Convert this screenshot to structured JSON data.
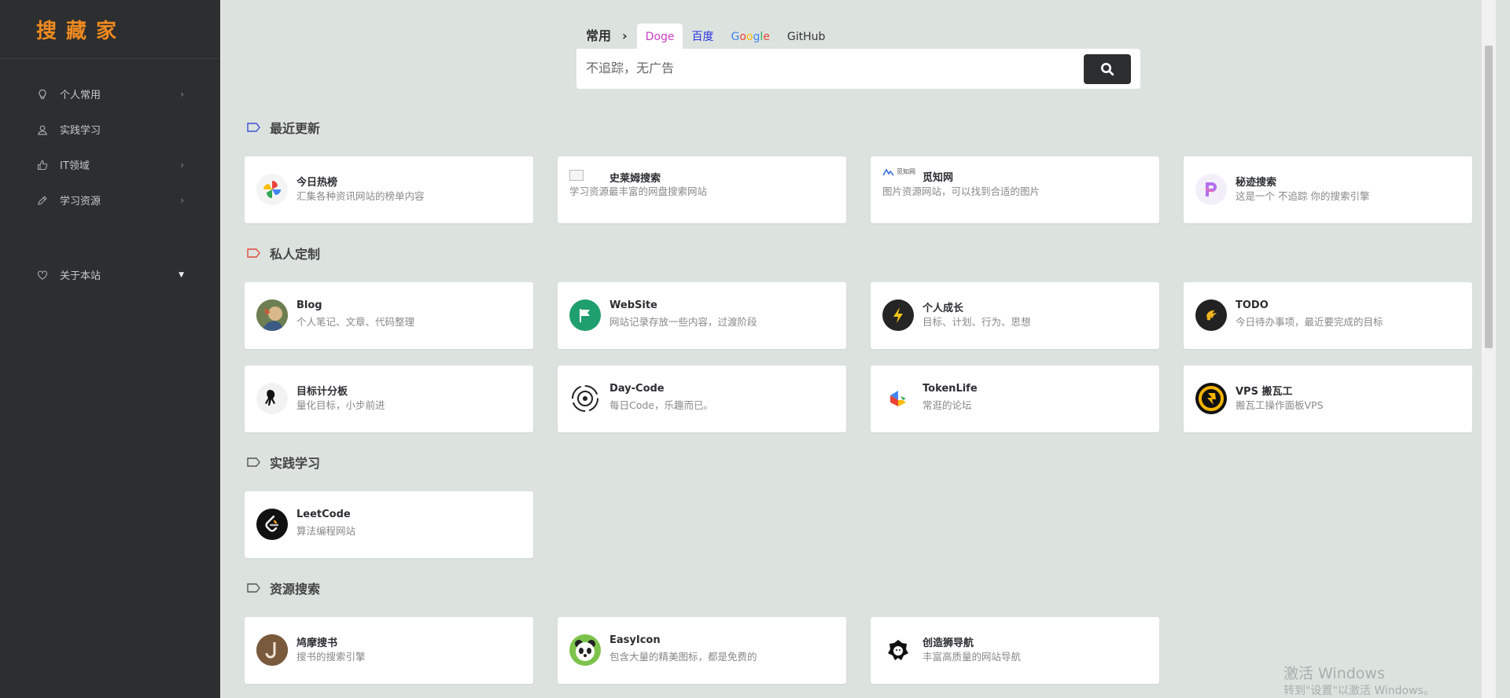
{
  "logo": "搜藏家",
  "sidebar": {
    "items": [
      {
        "label": "个人常用",
        "has_arrow": true
      },
      {
        "label": "实践学习",
        "has_arrow": false
      },
      {
        "label": "IT领域",
        "has_arrow": true
      },
      {
        "label": "学习资源",
        "has_arrow": true
      }
    ],
    "about": {
      "label": "关于本站"
    },
    "arrow_glyph": "›",
    "about_glyph": "▼"
  },
  "search": {
    "group_label": "常用",
    "group_chevron": "›",
    "tabs": {
      "doge": "Doge",
      "baidu": "百度",
      "github": "GitHub"
    },
    "google": {
      "g1": "G",
      "o1": "o",
      "o2": "o",
      "g2": "g",
      "l": "l",
      "e": "e"
    },
    "placeholder": "不追踪，无广告"
  },
  "sections": {
    "recent": {
      "title": "最近更新",
      "cards": [
        {
          "title": "今日热榜",
          "desc": "汇集各种资讯网站的榜单内容"
        },
        {
          "title": "史莱姆搜索",
          "desc": "学习资源最丰富的网盘搜索网站"
        },
        {
          "title": "觅知网",
          "desc": "图片资源网站，可以找到合适的图片",
          "logo_text": "觅知网"
        },
        {
          "title": "秘迹搜索",
          "desc": "这是一个 不追踪 你的搜索引擎"
        }
      ]
    },
    "private": {
      "title": "私人定制",
      "cards": [
        {
          "title": "Blog",
          "desc": "个人笔记、文章、代码整理"
        },
        {
          "title": "WebSite",
          "desc": "网站记录存放一些内容，过渡阶段"
        },
        {
          "title": "个人成长",
          "desc": "目标、计划、行为、思想"
        },
        {
          "title": "TODO",
          "desc": "今日待办事项，最近要完成的目标"
        },
        {
          "title": "目标计分板",
          "desc": "量化目标，小步前进"
        },
        {
          "title": "Day-Code",
          "desc": "每日Code，乐趣而已。"
        },
        {
          "title": "TokenLife",
          "desc": "常逛的论坛"
        },
        {
          "title": "VPS 搬瓦工",
          "desc": "搬瓦工操作面板VPS"
        }
      ]
    },
    "practice": {
      "title": "实践学习",
      "cards": [
        {
          "title": "LeetCode",
          "desc": "算法编程网站"
        }
      ]
    },
    "resources": {
      "title": "资源搜索",
      "cards": [
        {
          "title": "鸠摩搜书",
          "desc": "搜书的搜索引擎"
        },
        {
          "title": "EasyIcon",
          "desc": "包含大量的精美图标，都是免费的"
        },
        {
          "title": "创造狮导航",
          "desc": "丰富高质量的网站导航"
        }
      ]
    }
  },
  "watermark": {
    "line1": "激活 Windows",
    "line2": "转到\"设置\"以激活 Windows。"
  },
  "colors": {
    "sidebar_bg": "#2c2e2f",
    "page_bg": "#dce3df",
    "logo": "#ef8a1f",
    "doge_tab": "#cc3fc4",
    "baidu_tab": "#2932e1"
  }
}
